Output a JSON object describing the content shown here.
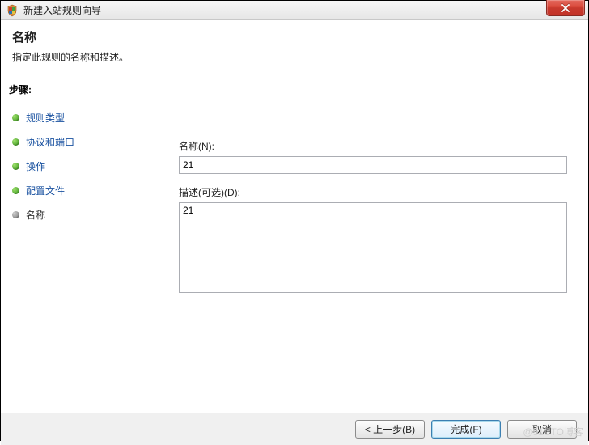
{
  "window": {
    "title": "新建入站规则向导"
  },
  "header": {
    "title": "名称",
    "description": "指定此规则的名称和描述。"
  },
  "sidebar": {
    "steps_label": "步骤:",
    "items": [
      {
        "label": "规则类型",
        "current": false
      },
      {
        "label": "协议和端口",
        "current": false
      },
      {
        "label": "操作",
        "current": false
      },
      {
        "label": "配置文件",
        "current": false
      },
      {
        "label": "名称",
        "current": true
      }
    ]
  },
  "form": {
    "name_label": "名称(N):",
    "name_value": "21",
    "desc_label": "描述(可选)(D):",
    "desc_value": "21"
  },
  "footer": {
    "back_label": "< 上一步(B)",
    "finish_label": "完成(F)",
    "cancel_label": "取消"
  },
  "watermark": "@51CTO博客"
}
